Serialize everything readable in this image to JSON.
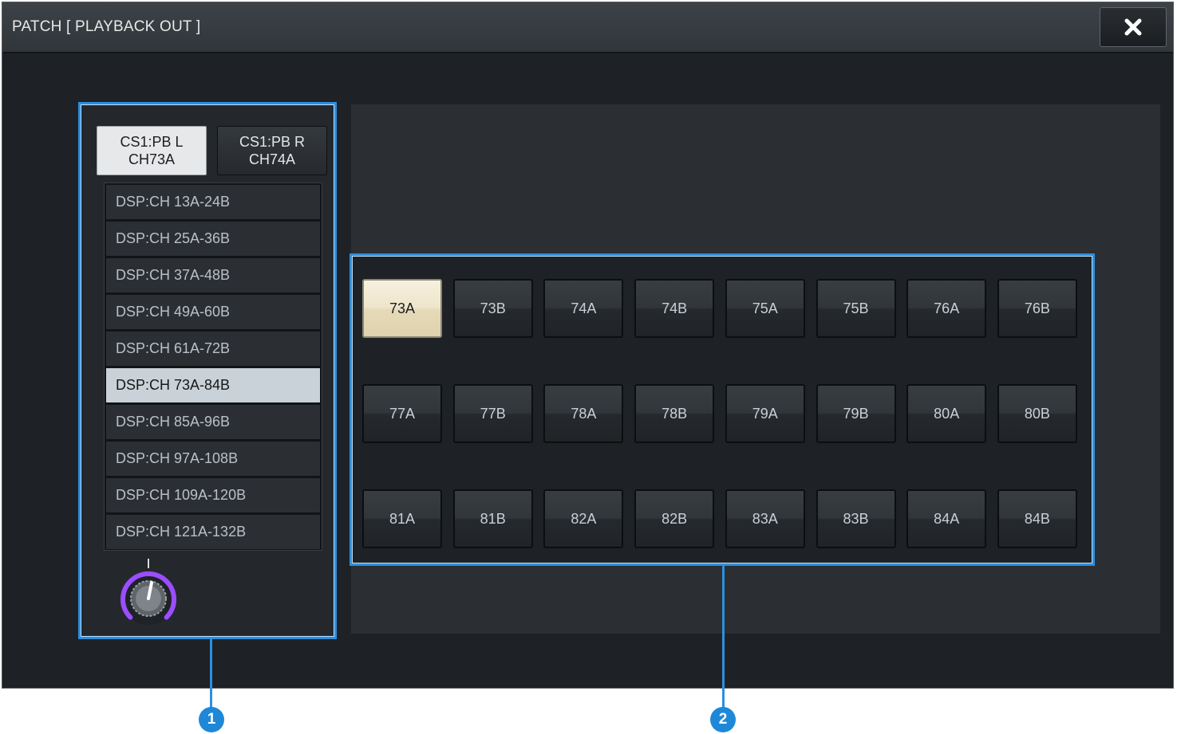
{
  "window": {
    "title": "PATCH  [ PLAYBACK OUT ]",
    "close_icon": "close-icon"
  },
  "channels": [
    {
      "line1": "CS1:PB L",
      "line2": "CH73A",
      "selected": true
    },
    {
      "line1": "CS1:PB R",
      "line2": "CH74A",
      "selected": false
    }
  ],
  "list": {
    "items": [
      "DSP:CH 13A-24B",
      "DSP:CH 25A-36B",
      "DSP:CH 37A-48B",
      "DSP:CH 49A-60B",
      "DSP:CH 61A-72B",
      "DSP:CH 73A-84B",
      "DSP:CH 85A-96B",
      "DSP:CH 97A-108B",
      "DSP:CH 109A-120B",
      "DSP:CH 121A-132B"
    ],
    "selected_index": 5
  },
  "knob": {
    "icon": "scroll-knob-icon",
    "ring_color": "#9b4dff"
  },
  "grid": {
    "cells": [
      "73A",
      "73B",
      "74A",
      "74B",
      "75A",
      "75B",
      "76A",
      "76B",
      "77A",
      "77B",
      "78A",
      "78B",
      "79A",
      "79B",
      "80A",
      "80B",
      "81A",
      "81B",
      "82A",
      "82B",
      "83A",
      "83B",
      "84A",
      "84B"
    ],
    "active": "73A"
  },
  "callouts": [
    "1",
    "2"
  ],
  "colors": {
    "highlight": "#2f8fde",
    "active_cell": "#efe5cc"
  }
}
